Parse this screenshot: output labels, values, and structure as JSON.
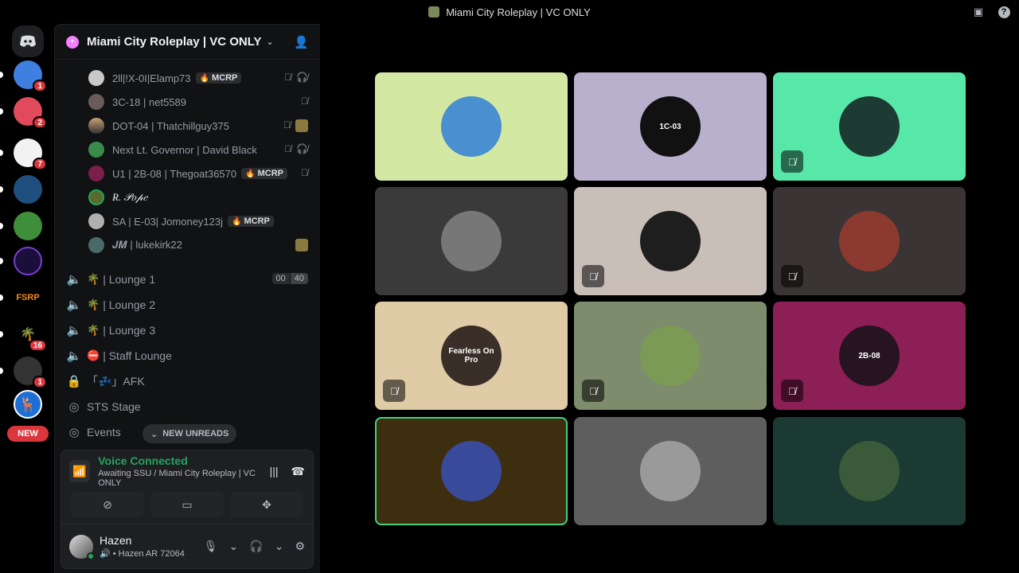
{
  "window": {
    "title": "Miami City Roleplay | VC ONLY"
  },
  "rail": {
    "badges": [
      "1",
      "2",
      "7",
      "16",
      "1"
    ],
    "new_label": "NEW"
  },
  "server": {
    "name": "Miami City Roleplay | VC ONLY"
  },
  "members": [
    {
      "name": "2ll|!X-0I|Elamp73",
      "tag": "MCRP",
      "icons": [
        "mic-off",
        "deafen-off"
      ]
    },
    {
      "name": "3C-18 | net5589",
      "tag": "",
      "icons": [
        "mic-off"
      ]
    },
    {
      "name": "DOT-04 | Thatchillguy375",
      "tag": "",
      "icons": [
        "mic-off",
        "activity"
      ]
    },
    {
      "name": "Next Lt. Governor | David Black",
      "tag": "",
      "icons": [
        "mic-off",
        "deafen-off"
      ]
    },
    {
      "name": "U1 | 2B-08 | Thegoat36570",
      "tag": "MCRP",
      "icons": [
        "mic-off"
      ]
    },
    {
      "name": "R. 𝒫𝑜𝓅𝑒",
      "tag": "",
      "icons": []
    },
    {
      "name": "SA | E-03| Jomoney123j",
      "tag": "MCRP",
      "icons": []
    },
    {
      "name": "𝑱𝑴 | lukekirk22",
      "tag": "",
      "icons": [
        "activity"
      ]
    }
  ],
  "channels": [
    {
      "name": "| Lounge 1",
      "emoji": "🌴",
      "icon": "speaker-icon",
      "limit": [
        "00",
        "40"
      ]
    },
    {
      "name": "| Lounge 2",
      "emoji": "🌴",
      "icon": "speaker-icon"
    },
    {
      "name": "| Lounge 3",
      "emoji": "🌴",
      "icon": "speaker-icon"
    },
    {
      "name": "| Staff Lounge",
      "emoji": "⛔",
      "icon": "speaker-locked-icon"
    },
    {
      "name": "「💤」AFK",
      "emoji": "",
      "icon": "lock-icon"
    },
    {
      "name": "STS Stage",
      "emoji": "",
      "icon": "stage-icon"
    },
    {
      "name": "Events",
      "emoji": "",
      "icon": "stage-icon"
    }
  ],
  "new_unreads": "NEW UNREADS",
  "voice": {
    "status": "Voice Connected",
    "location": "Awaiting SSU / Miami City Roleplay | VC ONLY"
  },
  "user": {
    "name": "Hazen",
    "status": "• Hazen AR 72064"
  },
  "tiles": [
    {
      "bg": "#d3e8a2",
      "muted": false,
      "avatar": "#4a8fd0",
      "text": ""
    },
    {
      "bg": "#b8b0cc",
      "muted": false,
      "avatar": "#111111",
      "text": "1C-03"
    },
    {
      "bg": "#57e8a9",
      "muted": true,
      "avatar": "#1d3b33",
      "text": ""
    },
    {
      "bg": "#3a3a3a",
      "muted": false,
      "avatar": "#777777",
      "text": ""
    },
    {
      "bg": "#c9bfb8",
      "muted": true,
      "avatar": "#1e1e1e",
      "text": ""
    },
    {
      "bg": "#3b3434",
      "muted": true,
      "avatar": "#8c3a30",
      "text": ""
    },
    {
      "bg": "#dfcba6",
      "muted": true,
      "avatar": "#3a2f28",
      "text": "Fearless On Pro"
    },
    {
      "bg": "#7c8c6c",
      "muted": true,
      "avatar": "#7a9a55",
      "text": ""
    },
    {
      "bg": "#8c1f55",
      "muted": true,
      "avatar": "#261420",
      "text": "2B-08"
    },
    {
      "bg": "#3d2e10",
      "muted": false,
      "avatar": "#3a4a9a",
      "text": "",
      "speaking": true
    },
    {
      "bg": "#5e5e5e",
      "muted": false,
      "avatar": "#9a9a9a",
      "text": ""
    },
    {
      "bg": "#1a3a33",
      "muted": false,
      "avatar": "#3a5a3a",
      "text": ""
    }
  ]
}
